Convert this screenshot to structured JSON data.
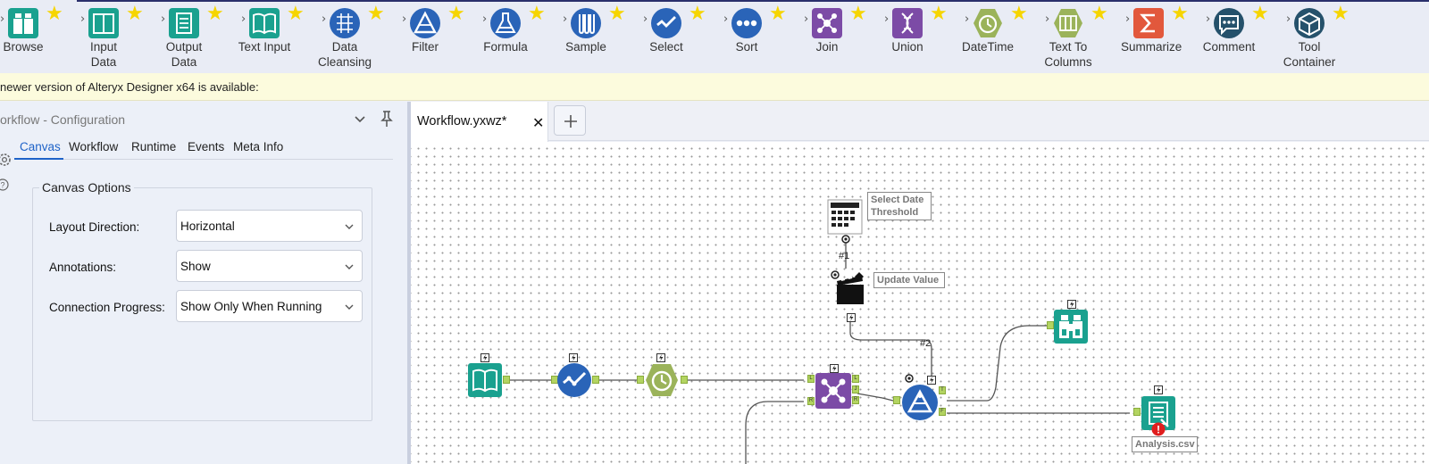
{
  "toolbar": {
    "tools": [
      {
        "id": "browse",
        "label": "Browse",
        "icon": "binoculars-icon",
        "color": "#1aa18f"
      },
      {
        "id": "input-data",
        "label": "Input Data",
        "icon": "book-icon",
        "color": "#1aa18f"
      },
      {
        "id": "output-data",
        "label": "Output Data",
        "icon": "document-icon",
        "color": "#1aa18f"
      },
      {
        "id": "text-input",
        "label": "Text Input",
        "icon": "open-book-icon",
        "color": "#1aa18f"
      },
      {
        "id": "data-cleansing",
        "label": "Data Cleansing",
        "icon": "grid-brush-icon",
        "color": "#2a64b8"
      },
      {
        "id": "filter",
        "label": "Filter",
        "icon": "triangle-filter-icon",
        "color": "#2a64b8"
      },
      {
        "id": "formula",
        "label": "Formula",
        "icon": "flask-icon",
        "color": "#2a64b8"
      },
      {
        "id": "sample",
        "label": "Sample",
        "icon": "test-tubes-icon",
        "color": "#2a64b8"
      },
      {
        "id": "select",
        "label": "Select",
        "icon": "checkmark-icon",
        "color": "#2a64b8"
      },
      {
        "id": "sort",
        "label": "Sort",
        "icon": "dots-icon",
        "color": "#2a64b8"
      },
      {
        "id": "join",
        "label": "Join",
        "icon": "network-icon",
        "color": "#7c4ba6"
      },
      {
        "id": "union",
        "label": "Union",
        "icon": "dna-icon",
        "color": "#7c4ba6"
      },
      {
        "id": "datetime",
        "label": "DateTime",
        "icon": "clock-icon",
        "color": "#9bb35a"
      },
      {
        "id": "text-to-columns",
        "label": "Text To Columns",
        "icon": "columns-icon",
        "color": "#9bb35a"
      },
      {
        "id": "summarize",
        "label": "Summarize",
        "icon": "sigma-icon",
        "color": "#e2583c"
      },
      {
        "id": "comment",
        "label": "Comment",
        "icon": "speech-bubble-icon",
        "color": "#25516b"
      },
      {
        "id": "tool-container",
        "label": "Tool Container",
        "icon": "cube-icon",
        "color": "#25516b"
      }
    ]
  },
  "notice": {
    "text": "newer version of Alteryx Designer x64 is available:"
  },
  "config": {
    "title": "orkflow - Configuration",
    "tabs": [
      "Canvas",
      "Workflow",
      "Runtime",
      "Events",
      "Meta Info"
    ],
    "active_tab": "Canvas",
    "group_title": "Canvas Options",
    "options": [
      {
        "label": "Layout Direction:",
        "value": "Horizontal"
      },
      {
        "label": "Annotations:",
        "value": "Show"
      },
      {
        "label": "Connection Progress:",
        "value": "Show Only When Running"
      }
    ]
  },
  "tabs": {
    "workflow_tab": "Workflow.yxwz*"
  },
  "canvas": {
    "annotations": {
      "date_threshold": "Select Date Threshold",
      "update_value": "Update Value",
      "output_file": "Analysis.csv"
    },
    "connection_labels": {
      "c1": "#1",
      "c2": "#2"
    },
    "port_labels": {
      "join_l": "L",
      "join_r": "R",
      "join_j": "J",
      "filter_t": "T",
      "filter_f": "F"
    }
  }
}
